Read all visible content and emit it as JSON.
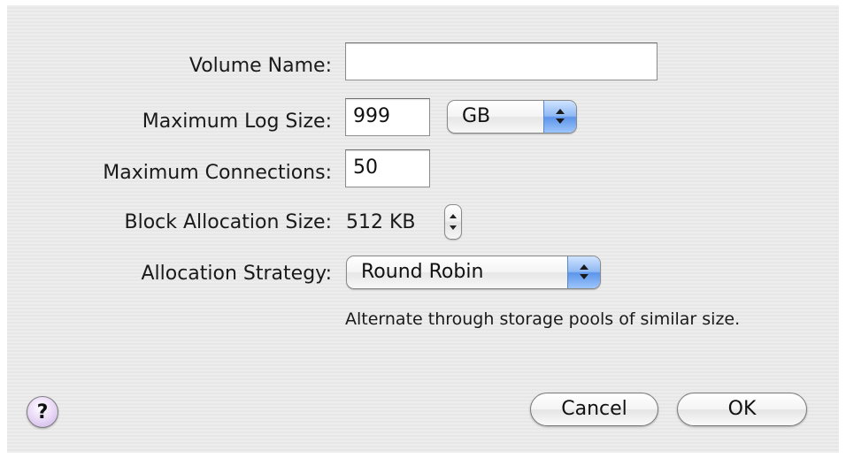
{
  "form": {
    "volume_name": {
      "label": "Volume Name:",
      "value": ""
    },
    "max_log_size": {
      "label": "Maximum Log Size:",
      "value": "999",
      "unit": "GB"
    },
    "max_connections": {
      "label": "Maximum Connections:",
      "value": "50"
    },
    "block_allocation": {
      "label": "Block Allocation Size:",
      "value": "512 KB"
    },
    "allocation_strategy": {
      "label": "Allocation Strategy:",
      "value": "Round Robin",
      "description": "Alternate through storage pools of similar size."
    }
  },
  "buttons": {
    "help_label": "?",
    "cancel_label": "Cancel",
    "ok_label": "OK"
  },
  "icons": {
    "popup_arrows": "up-down-arrows-icon",
    "stepper": "stepper-arrows-icon",
    "help": "question-mark-icon"
  },
  "colors": {
    "popup_accent": "#6a9ff0",
    "help_button": "#d9c6f0",
    "dialog_background": "#ececec"
  }
}
